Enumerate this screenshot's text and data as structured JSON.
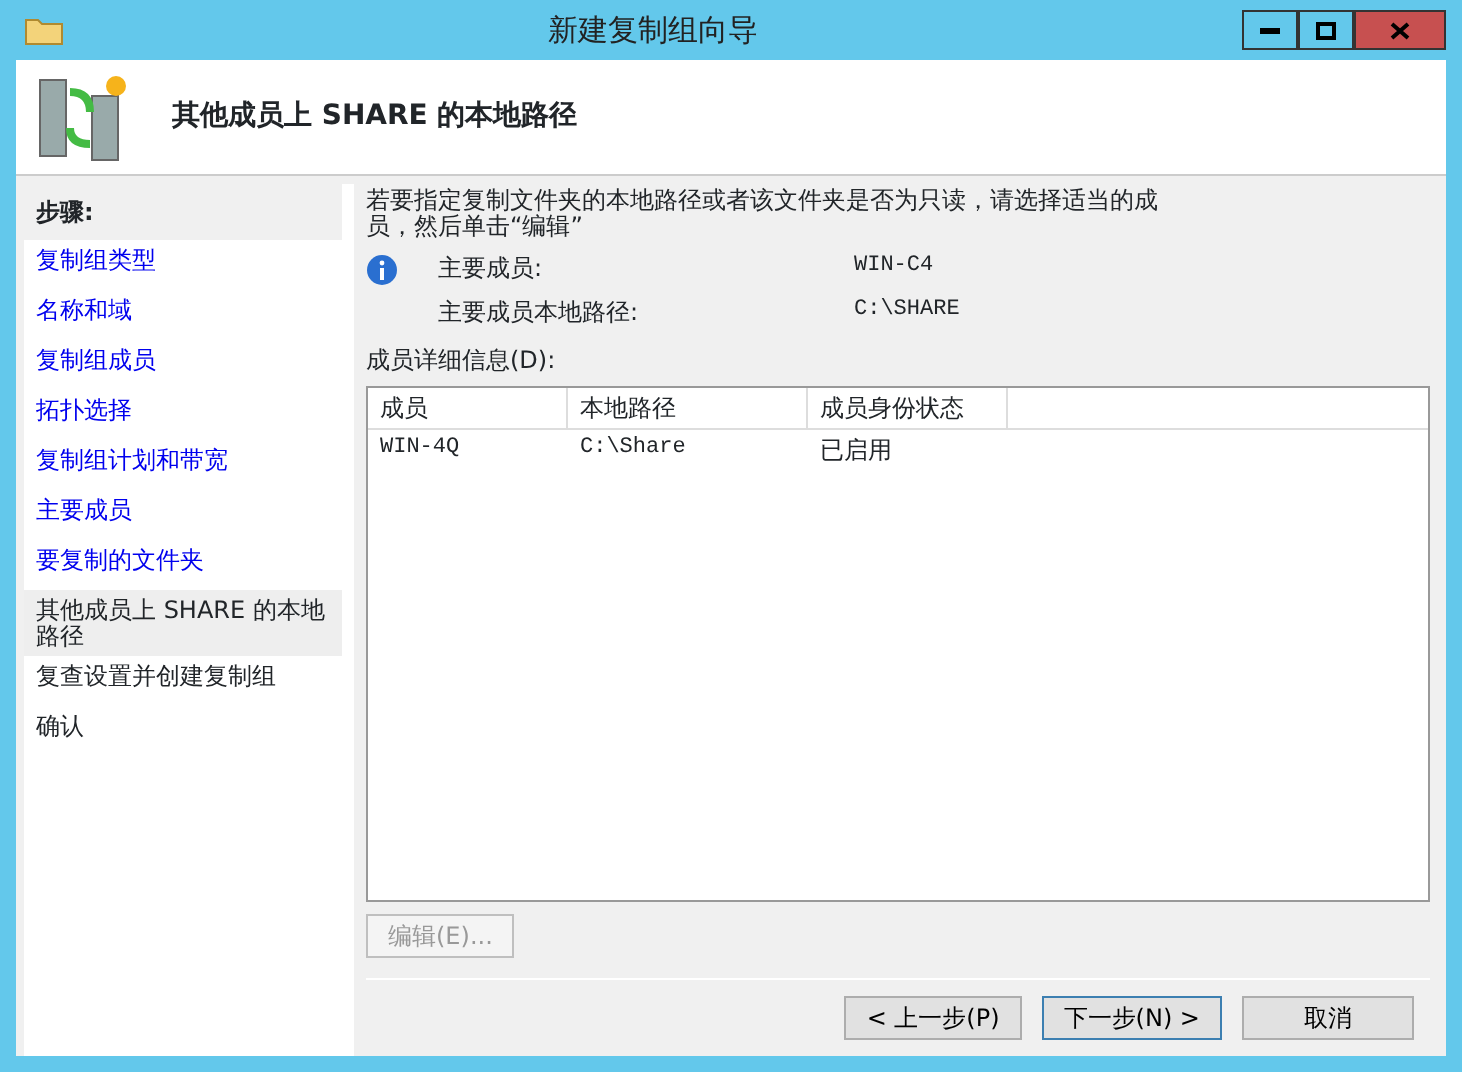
{
  "window": {
    "title": "新建复制组向导"
  },
  "header": {
    "title": "其他成员上 SHARE 的本地路径"
  },
  "steps": {
    "title": "步骤:",
    "items": [
      {
        "label": "复制组类型",
        "visited": true,
        "selected": false
      },
      {
        "label": "名称和域",
        "visited": true,
        "selected": false
      },
      {
        "label": "复制组成员",
        "visited": true,
        "selected": false
      },
      {
        "label": "拓扑选择",
        "visited": true,
        "selected": false
      },
      {
        "label": "复制组计划和带宽",
        "visited": true,
        "selected": false
      },
      {
        "label": "主要成员",
        "visited": true,
        "selected": false
      },
      {
        "label": "要复制的文件夹",
        "visited": true,
        "selected": false
      },
      {
        "label": "其他成员上 SHARE 的本地路径",
        "visited": false,
        "selected": true
      },
      {
        "label": "复查设置并创建复制组",
        "visited": false,
        "selected": false
      },
      {
        "label": "确认",
        "visited": false,
        "selected": false
      }
    ]
  },
  "instructions": "若要指定复制文件夹的本地路径或者该文件夹是否为只读，请选择适当的成员，然后单击“编辑”",
  "info": [
    {
      "label": "主要成员:",
      "value": "WIN-C4"
    },
    {
      "label": "主要成员本地路径:",
      "value": "C:\\SHARE"
    }
  ],
  "members": {
    "label": "成员详细信息(D):",
    "columns": [
      "成员",
      "本地路径",
      "成员身份状态"
    ],
    "rows": [
      [
        "WIN-4Q",
        "C:\\Share",
        "已启用"
      ]
    ]
  },
  "edit_button": {
    "label": "编辑(E)...",
    "disabled": true
  },
  "buttons": [
    {
      "label": "< 上一步(P)",
      "default": false
    },
    {
      "label": "下一步(N) >",
      "default": true
    },
    {
      "label": "取消",
      "default": false
    }
  ]
}
